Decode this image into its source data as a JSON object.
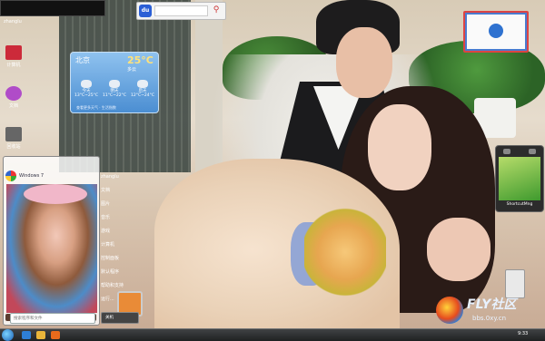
{
  "desktop": {
    "top_window_label": "zhanglu",
    "icons": [
      {
        "name": "computer-icon",
        "label": "计算机",
        "color": "#cc2a3a"
      },
      {
        "name": "user-folder-icon",
        "label": "文档",
        "color": "#b04cc8"
      },
      {
        "name": "recycle-bin-icon",
        "label": "回收站",
        "color": "#666666"
      }
    ]
  },
  "baidu_search": {
    "logo": "du",
    "placeholder": "",
    "go_icon": "search-icon"
  },
  "weather": {
    "city": "北京",
    "temperature": "25°C",
    "condition": "多云",
    "days": [
      {
        "name": "今天",
        "range": "13°C~25°C"
      },
      {
        "name": "明天",
        "range": "11°C~22°C"
      },
      {
        "name": "后天",
        "range": "12°C~24°C"
      }
    ],
    "footer": "查看更多天气 · 生活指数"
  },
  "gadget": {
    "label": "ShortcutMng"
  },
  "start_menu": {
    "logo_text": "Windows 7",
    "right_items": [
      "zhanglu",
      "文档",
      "图片",
      "音乐",
      "游戏",
      "计算机",
      "控制面板",
      "默认程序",
      "帮助和支持",
      "运行..."
    ],
    "all_programs": "所有程序",
    "search_placeholder": "搜索程序和文件",
    "shutdown": "关机"
  },
  "taskbar": {
    "clock": "9:33",
    "pinned": [
      {
        "name": "ie-icon",
        "color": "#2e7fd6"
      },
      {
        "name": "explorer-icon",
        "color": "#e9b53a"
      },
      {
        "name": "media-player-icon",
        "color": "#e86a1c"
      }
    ]
  },
  "watermark": {
    "brand": "FLY社区",
    "url": "bbs.0xy.cn"
  },
  "colors": {
    "accent": "#2b5fd6",
    "weather_temp": "#ffe27a"
  }
}
